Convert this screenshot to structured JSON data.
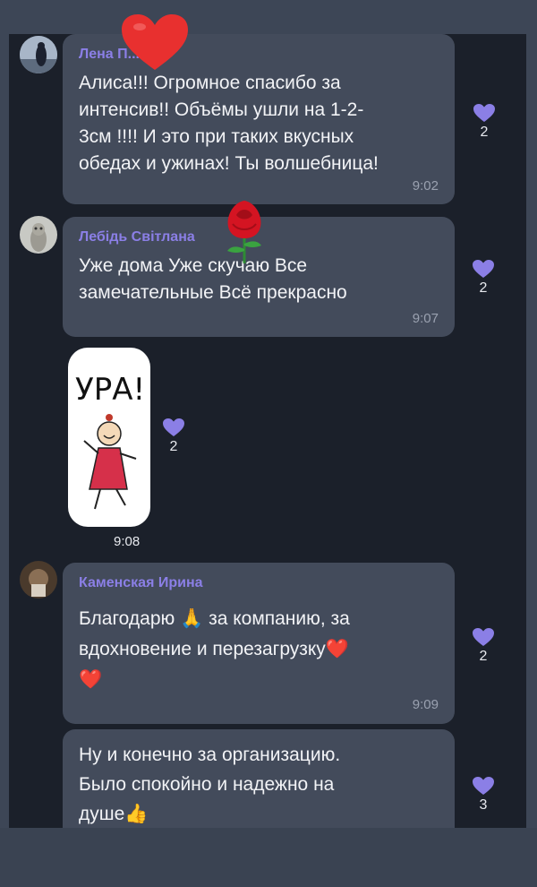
{
  "colors": {
    "page_bg": "#3d4656",
    "chat_bg": "#1b202a",
    "bubble_bg": "#434b5b",
    "sender_color": "#8b7fe6",
    "like_color": "#8b7fe6"
  },
  "messages": [
    {
      "sender": "Лена П... ес",
      "text": "Алиса!!! Огромное спасибо за\nинтенсив!! Объёмы ушли на 1-2-\n3см !!!! И это при таких вкусных\nобедах и ужинах! Ты волшебница!",
      "time": "9:02",
      "likes": "2",
      "like_icon": "purple-heart-icon"
    },
    {
      "sender": "Лебідь Світлана",
      "text": "Уже дома Уже скучаю  Все\nзамечательные Всё прекрасно",
      "time": "9:07",
      "likes": "2",
      "like_icon": "purple-heart-icon"
    },
    {
      "sticker_text": "УРА!",
      "time": "9:08",
      "likes": "2",
      "like_icon": "purple-heart-icon"
    },
    {
      "sender": "Каменская Ирина",
      "text": "Благодарю 🙏 за компанию, за\nвдохновение и перезагрузку❤️\n❤️",
      "time": "9:09",
      "likes": "2",
      "like_icon": "purple-heart-icon"
    },
    {
      "text": "Ну и конечно за организацию.\nБыло спокойно и надежно на\nдуше👍",
      "likes": "3",
      "like_icon": "purple-heart-icon"
    }
  ],
  "overlays": {
    "heart_icon": "red-heart-sticker",
    "rose_icon": "rose-sticker"
  }
}
